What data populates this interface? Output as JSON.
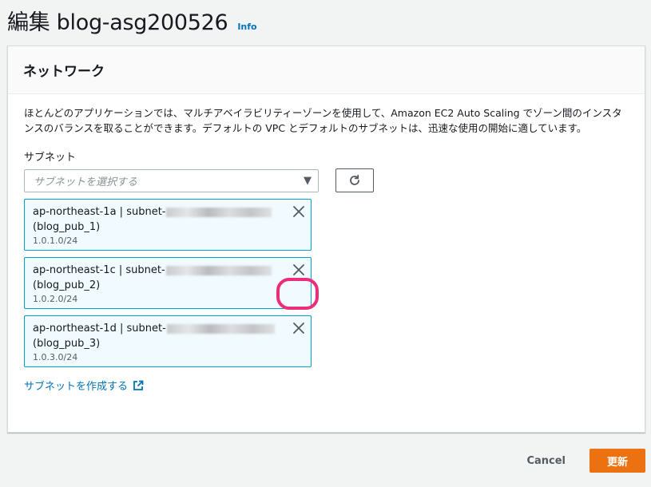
{
  "header": {
    "title": "編集 blog-asg200526",
    "info": "Info"
  },
  "panel": {
    "title": "ネットワーク",
    "description": "ほとんどのアプリケーションでは、マルチアベイラビリティーゾーンを使用して、Amazon EC2 Auto Scaling でゾーン間のインスタンスのバランスを取ることができます。デフォルトの VPC とデフォルトのサブネットは、迅速な使用の開始に適しています。",
    "subnet_label": "サブネット",
    "subnet_placeholder": "サブネットを選択する",
    "create_subnet_link": "サブネットを作成する"
  },
  "subnets": [
    {
      "line1": "ap-northeast-1a | subnet-",
      "name": "(blog_pub_1)",
      "cidr": "1.0.1.0/24"
    },
    {
      "line1": "ap-northeast-1c | subnet-",
      "name": "(blog_pub_2)",
      "cidr": "1.0.2.0/24"
    },
    {
      "line1": "ap-northeast-1d | subnet-",
      "name": "(blog_pub_3)",
      "cidr": "1.0.3.0/24"
    }
  ],
  "footer": {
    "cancel": "Cancel",
    "update": "更新"
  },
  "colors": {
    "accent": "#0073bb",
    "primary_button": "#ec7211",
    "token_border": "#00a1c9",
    "token_bg": "#f1faff",
    "highlight": "#ec2d7a"
  }
}
